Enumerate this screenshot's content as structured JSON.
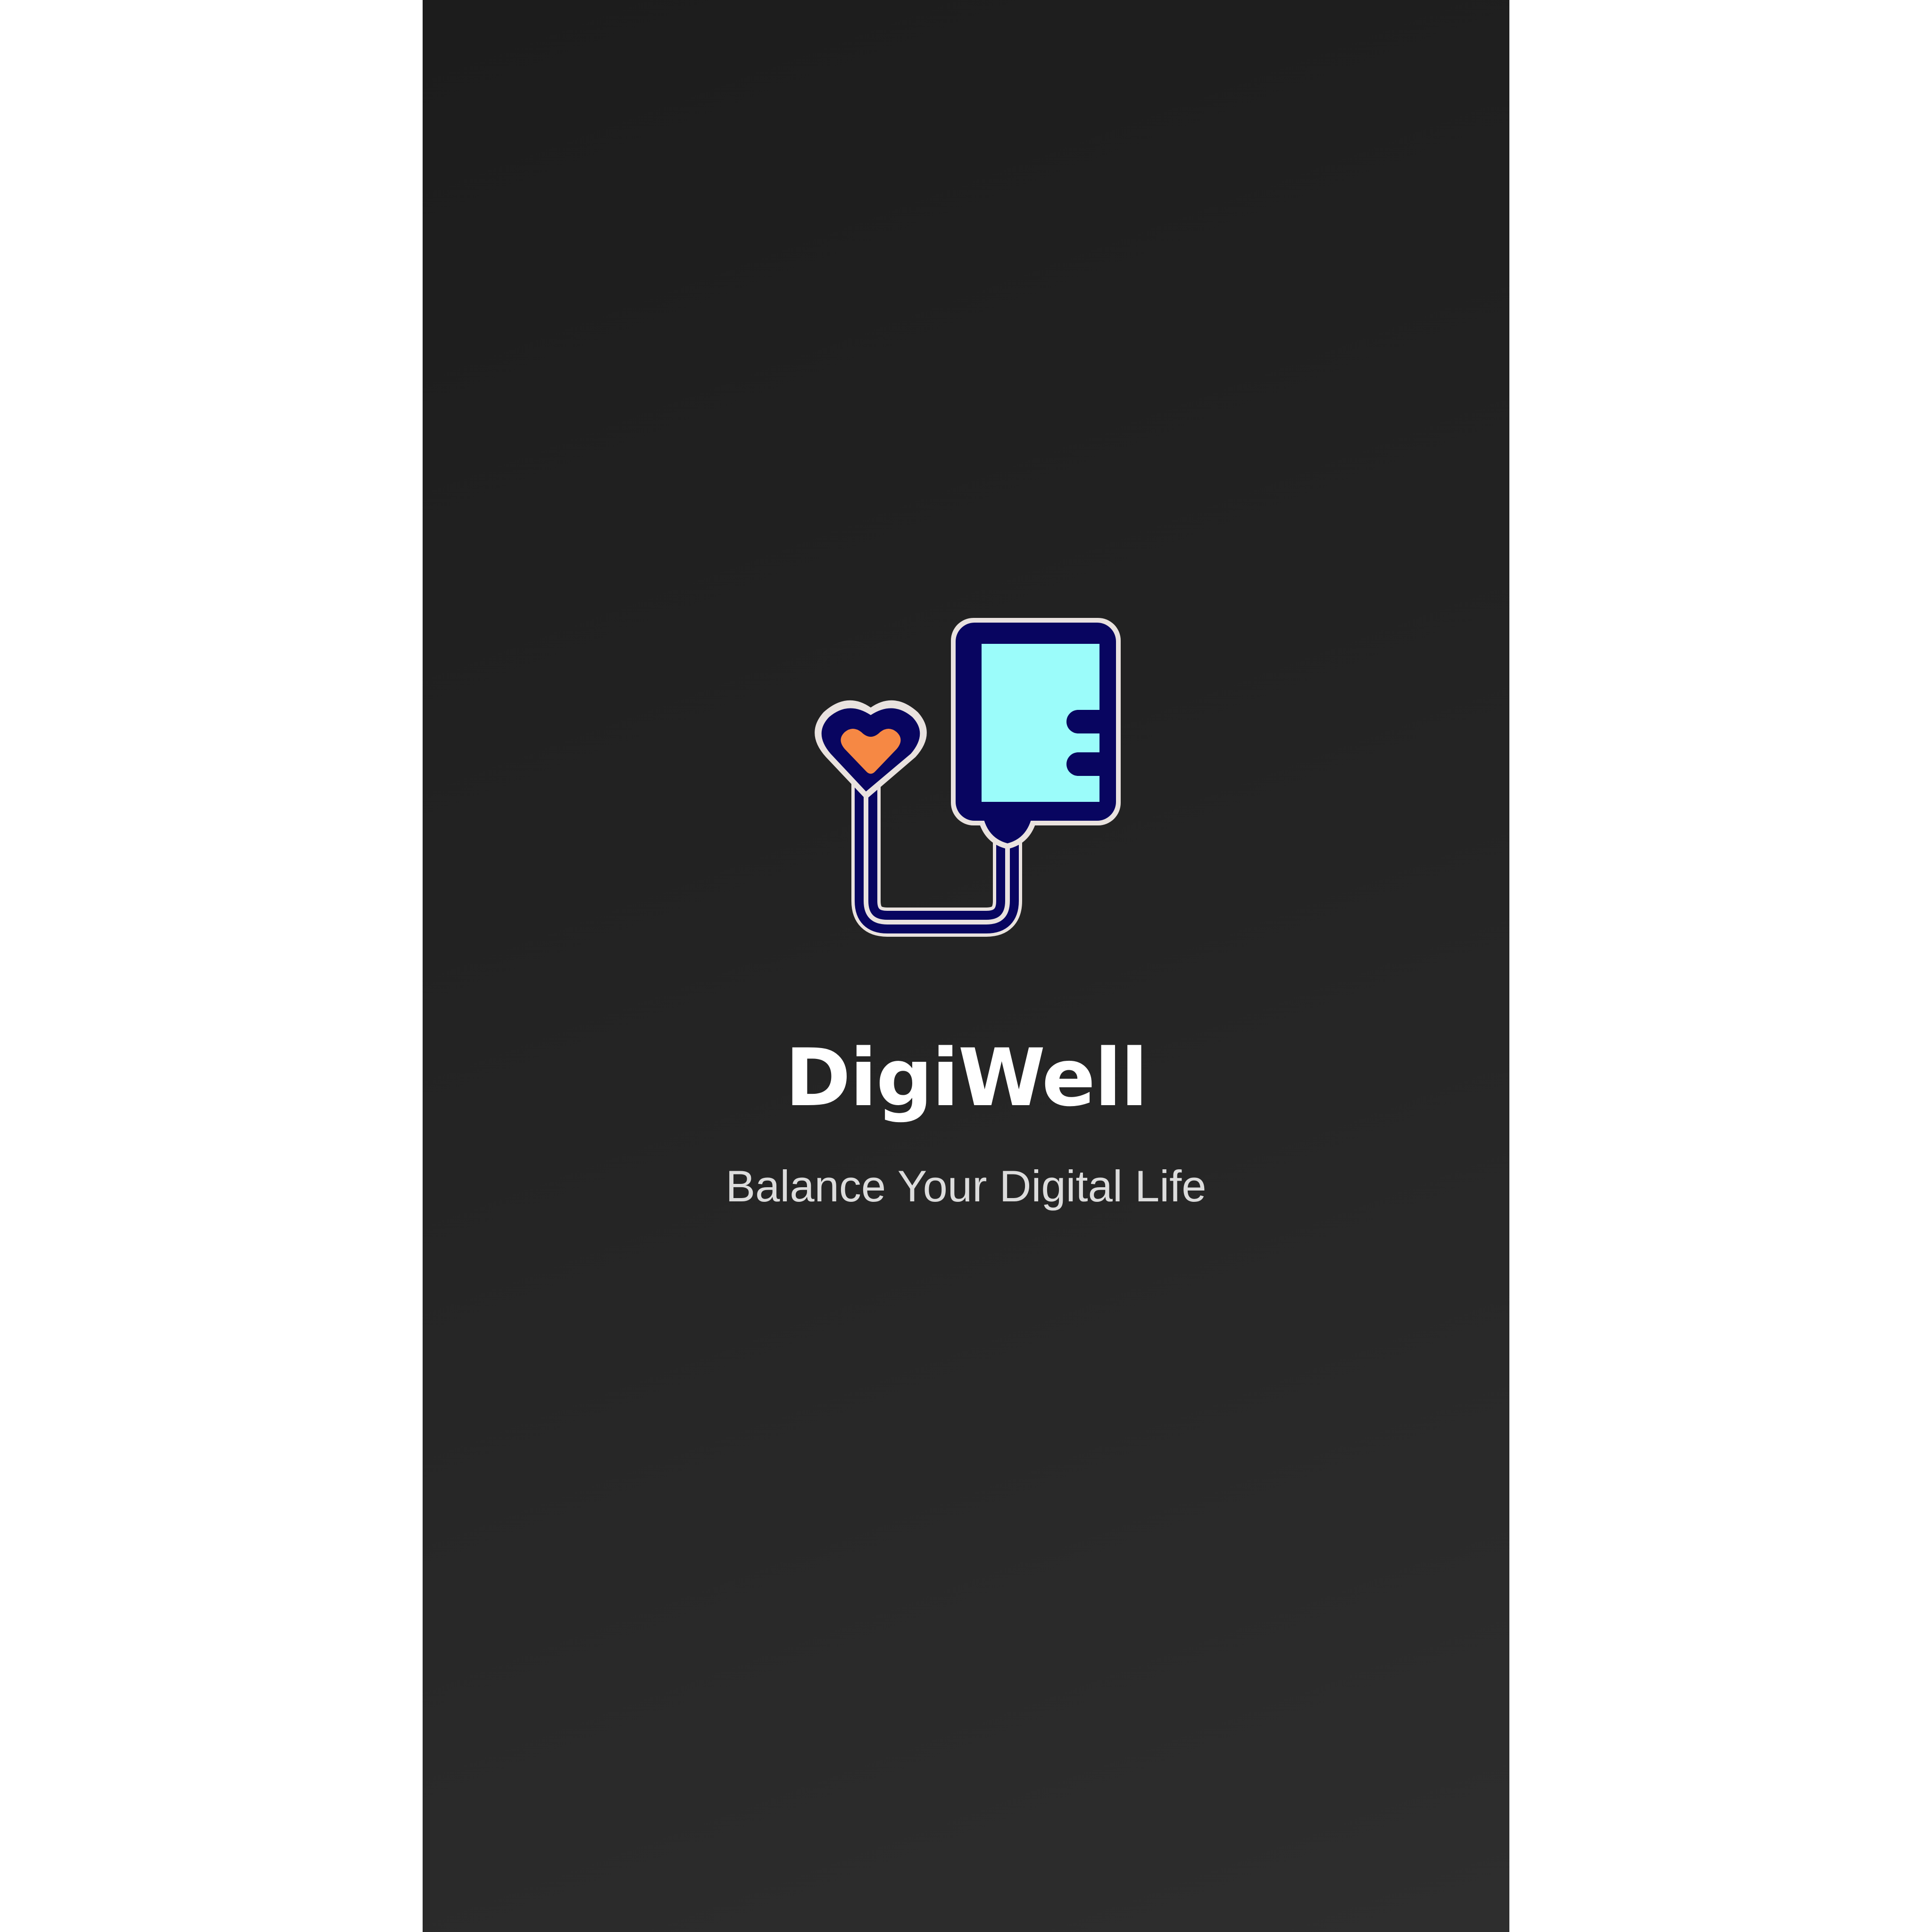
{
  "app": {
    "name": "DigiWell",
    "tagline": "Balance Your Digital Life"
  },
  "logo": {
    "icon": "heart-device-icon",
    "colors": {
      "outline": "#e9e2df",
      "body": "#080560",
      "screen": "#9bfcfa",
      "heart": "#f68844"
    }
  },
  "theme": {
    "background_top": "#1c1c1c",
    "background_bottom": "#2e2e2e",
    "text": "#ffffff",
    "subtext": "#dcdcdc"
  }
}
